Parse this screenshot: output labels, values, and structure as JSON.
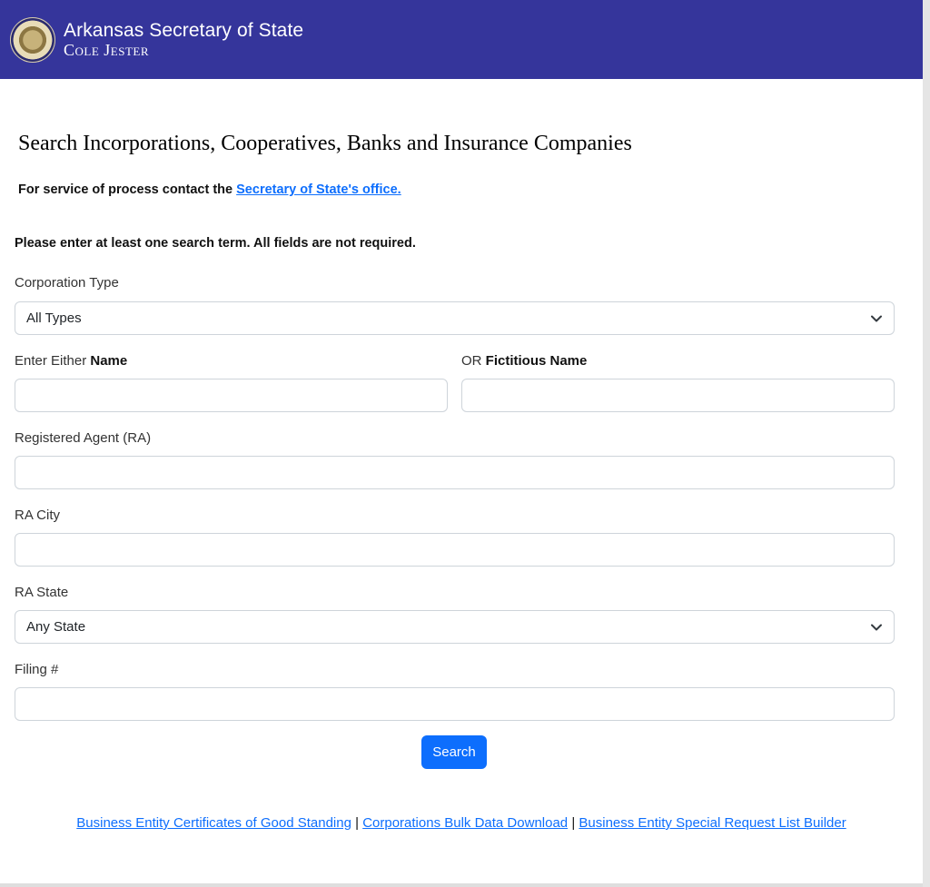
{
  "header": {
    "line1": "Arkansas Secretary of State",
    "line2": "Cole Jester"
  },
  "page": {
    "title": "Search Incorporations, Cooperatives, Banks and Insurance Companies",
    "service_text": "For service of process contact the ",
    "service_link": "Secretary of State's office.",
    "instruction": "Please enter at least one search term. All fields are not required."
  },
  "form": {
    "corp_type_label": "Corporation Type",
    "corp_type_value": "All Types",
    "name_label_prefix": "Enter Either ",
    "name_label_bold": "Name",
    "name_value": "",
    "fict_label_prefix": "OR ",
    "fict_label_bold": "Fictitious Name",
    "fict_value": "",
    "agent_label": "Registered Agent (RA)",
    "agent_value": "",
    "city_label": "RA City",
    "city_value": "",
    "state_label": "RA State",
    "state_value": "Any State",
    "filing_label": "Filing #",
    "filing_value": "",
    "search_label": "Search"
  },
  "footer": {
    "link1": "Business Entity Certificates of Good Standing",
    "sep": "|",
    "link2": "Corporations Bulk Data Download",
    "link3": "Business Entity Special Request List Builder"
  },
  "icons": {
    "seal": "state-seal-icon",
    "chevron": "chevron-down-icon"
  }
}
